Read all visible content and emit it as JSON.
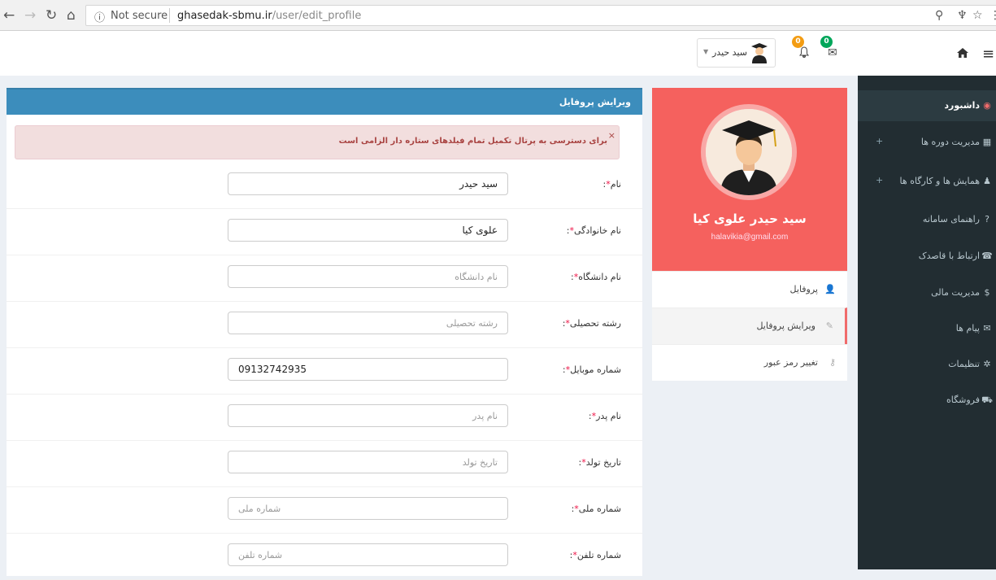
{
  "browser": {
    "security": "Not secure",
    "url_host": "ghasedak-sbmu.ir",
    "url_path": "/user/edit_profile"
  },
  "header": {
    "user_name": "سید حیدر",
    "messages_badge": "0",
    "notifications_badge": "0",
    "colors": {
      "messages_badge": "#00a65a",
      "notifications_badge": "#f39c12"
    }
  },
  "sidebar": {
    "items": [
      {
        "label": "داشبورد",
        "icon": "dashboard-icon",
        "active": true
      },
      {
        "label": "مدیریت دوره ها",
        "icon": "courses-icon",
        "plus": "+"
      },
      {
        "label": "همایش ها و کارگاه ها",
        "icon": "conference-icon",
        "plus": "+"
      },
      {
        "label": "راهنمای سامانه",
        "icon": "help-icon"
      },
      {
        "label": "ارتباط با قاصدک",
        "icon": "contact-icon"
      },
      {
        "label": "مدیریت مالی",
        "icon": "finance-icon"
      },
      {
        "label": "پیام ها",
        "icon": "message-icon"
      },
      {
        "label": "تنظیمات",
        "icon": "settings-icon"
      },
      {
        "label": "فروشگاه",
        "icon": "shop-icon"
      }
    ]
  },
  "profile": {
    "name": "سید حیدر علوی کیا",
    "email": "halavikia@gmail.com",
    "nav": [
      {
        "label": "پروفایل",
        "icon": "user-icon"
      },
      {
        "label": "ویرایش پروفایل",
        "icon": "edit-icon",
        "active": true
      },
      {
        "label": "تغییر رمز عبور",
        "icon": "key-icon"
      }
    ]
  },
  "form": {
    "title": "ویرایش پروفایل",
    "alert": "برای دسترسی به پرتال تکمیل تمام فیلدهای ستاره دار الزامی است",
    "fields": [
      {
        "label": "نام",
        "value": "سید حیدر",
        "placeholder": ""
      },
      {
        "label": "نام خانوادگی",
        "value": "علوی کیا",
        "placeholder": ""
      },
      {
        "label": "نام دانشگاه",
        "value": "",
        "placeholder": "نام دانشگاه"
      },
      {
        "label": "رشته تحصیلی",
        "value": "",
        "placeholder": "رشته تحصیلی"
      },
      {
        "label": "شماره موبایل",
        "value": "09132742935",
        "placeholder": ""
      },
      {
        "label": "نام پدر",
        "value": "",
        "placeholder": "نام پدر"
      },
      {
        "label": "تاریخ تولد",
        "value": "",
        "placeholder": "تاریخ تولد"
      },
      {
        "label": "شماره ملی",
        "value": "",
        "placeholder": "شماره ملی"
      },
      {
        "label": "شماره تلفن",
        "value": "",
        "placeholder": "شماره تلفن"
      }
    ]
  }
}
